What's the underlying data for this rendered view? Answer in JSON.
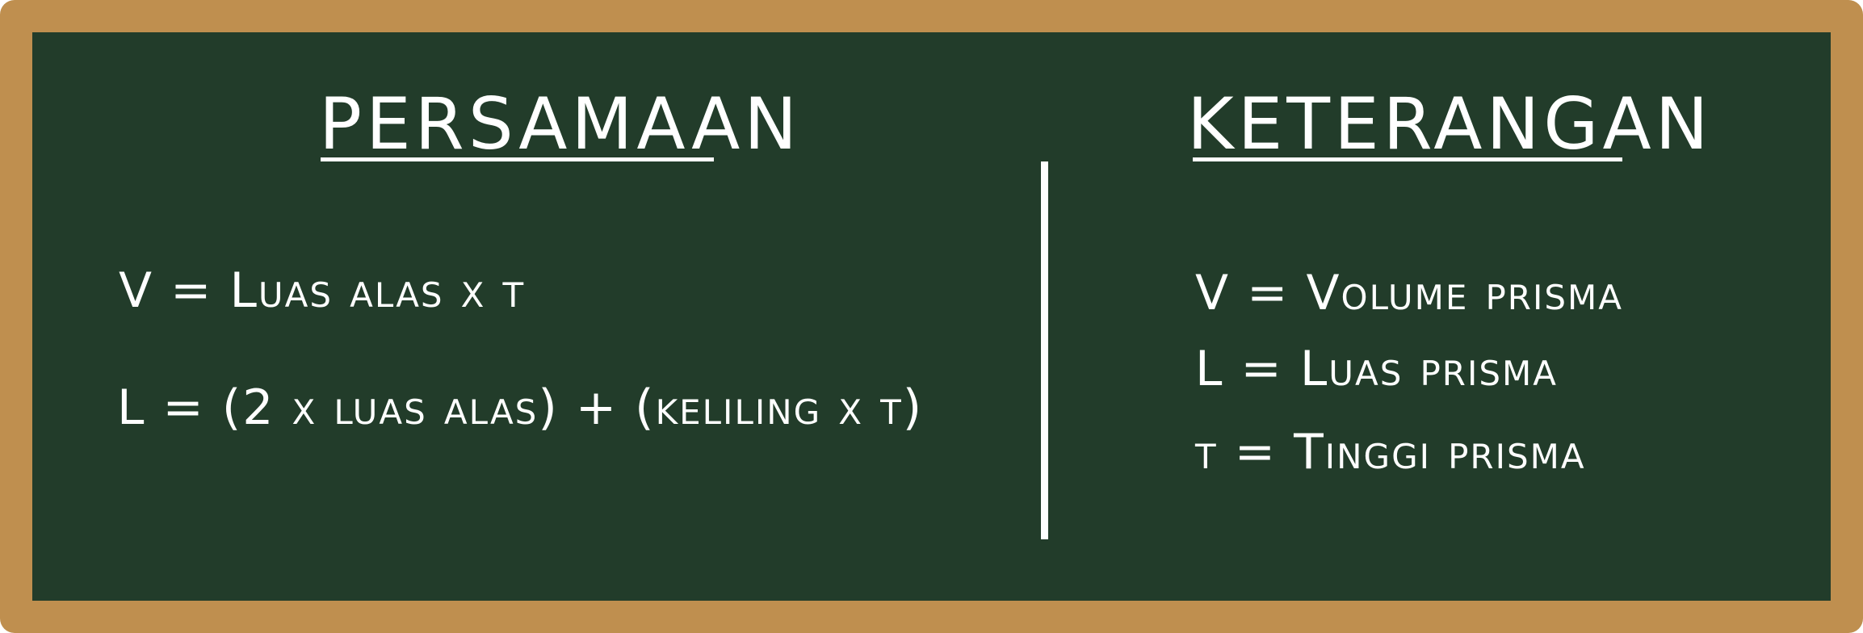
{
  "left_panel": {
    "heading": "PERSAMAAN",
    "equations": [
      "V = Luas alas x t",
      "L = (2 x luas alas) + (keliling x t)"
    ]
  },
  "right_panel": {
    "heading": "KETERANGAN",
    "definitions": [
      "V = Volume prisma",
      "L = Luas prisma",
      "t = Tinggi prisma"
    ]
  },
  "colors": {
    "frame": "#bf8f4f",
    "board": "#223c2a",
    "chalk": "#ffffff"
  }
}
